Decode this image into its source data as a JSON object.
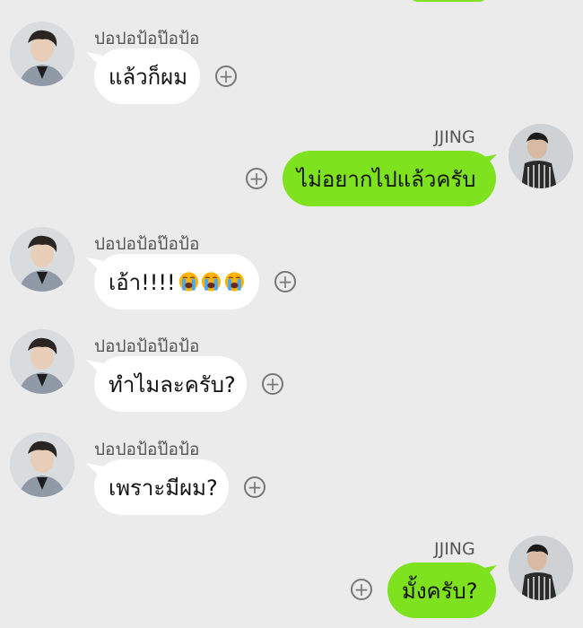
{
  "colors": {
    "background": "#ebebeb",
    "incoming_bubble": "#ffffff",
    "outgoing_bubble": "#7ee21f"
  },
  "messages": [
    {
      "direction": "incoming",
      "sender": "ปอปอป้อป๊อป้อ",
      "text": "แล้วก็ผม"
    },
    {
      "direction": "outgoing",
      "sender": "JJING",
      "text": "ไม่อยากไปแล้วครับ"
    },
    {
      "direction": "incoming",
      "sender": "ปอปอป้อป๊อป้อ",
      "text": "เอ้า!!!!",
      "emoji": [
        "loudly-crying-face",
        "loudly-crying-face",
        "loudly-crying-face"
      ]
    },
    {
      "direction": "incoming",
      "sender": "ปอปอป้อป๊อป้อ",
      "text": "ทำไมละครับ?"
    },
    {
      "direction": "incoming",
      "sender": "ปอปอป้อป๊อป้อ",
      "text": "เพราะมีผม?"
    },
    {
      "direction": "outgoing",
      "sender": "JJING",
      "text": "มั้งครับ?"
    }
  ],
  "icons": {
    "add": "circled-plus-icon",
    "avatar_in": "avatar-photo",
    "avatar_out": "avatar-photo"
  },
  "plus_glyph": "+"
}
